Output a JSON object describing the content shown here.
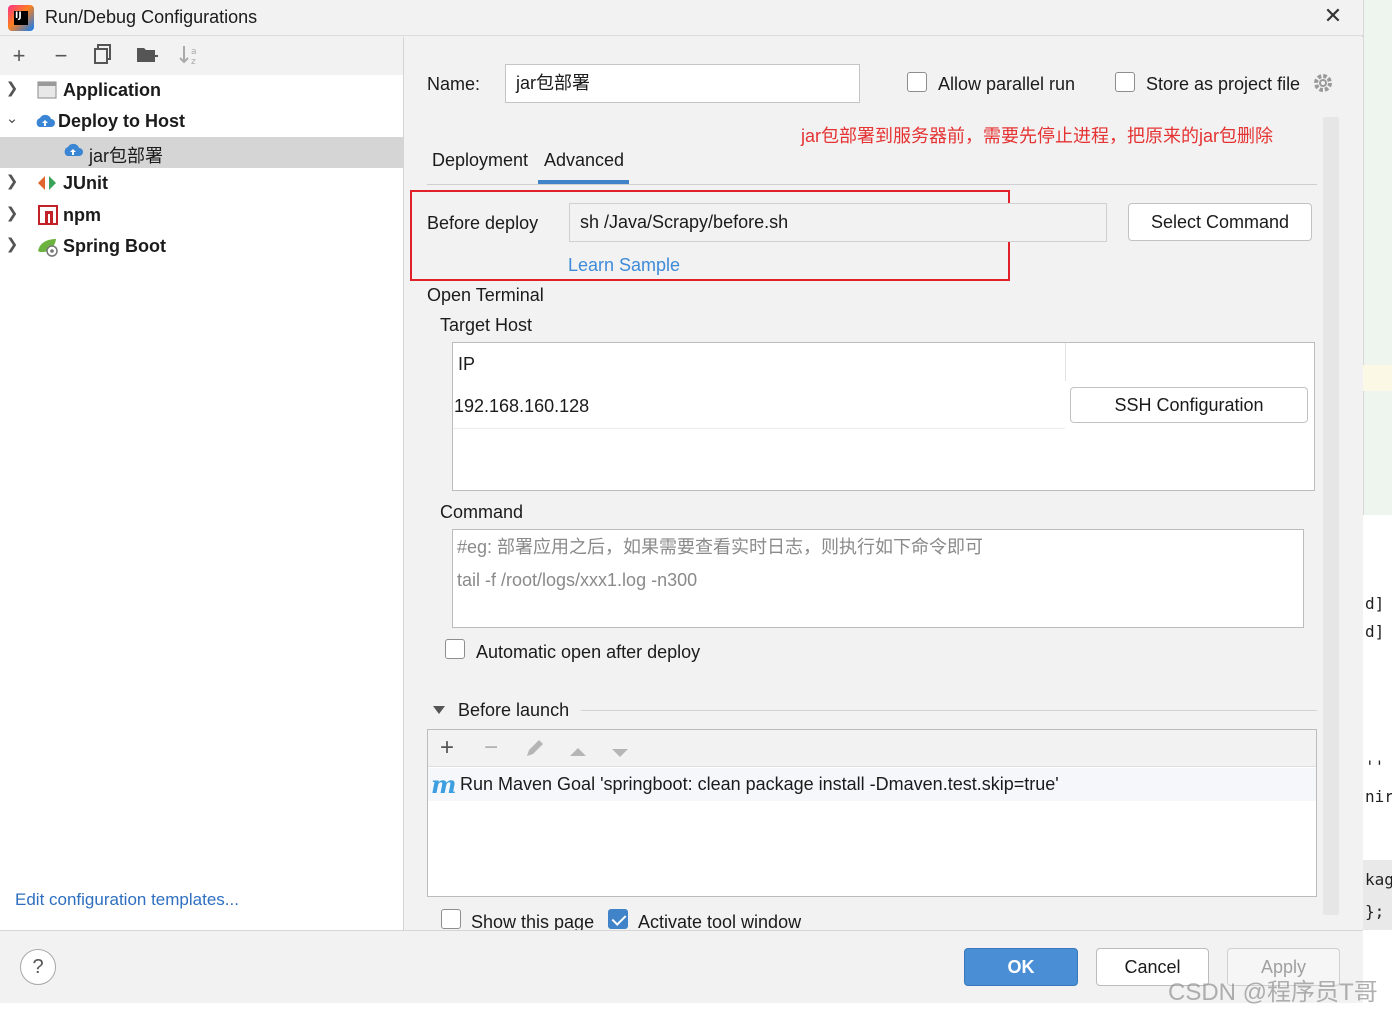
{
  "window": {
    "title": "Run/Debug Configurations"
  },
  "tree": {
    "items": [
      {
        "label": "Application"
      },
      {
        "label": "Deploy to Host"
      },
      {
        "label": "jar包部署"
      },
      {
        "label": "JUnit"
      },
      {
        "label": "npm"
      },
      {
        "label": "Spring Boot"
      }
    ],
    "edit_templates": "Edit configuration templates..."
  },
  "form": {
    "name_label": "Name:",
    "name_value": "jar包部署",
    "allow_parallel": "Allow parallel run",
    "store_project": "Store as project file",
    "annotation": "jar包部署到服务器前，需要先停止进程，把原来的jar包删除",
    "tabs": [
      "Deployment",
      "Advanced"
    ],
    "before_deploy_label": "Before deploy",
    "before_deploy_value": "sh /Java/Scrapy/before.sh",
    "select_command": "Select Command",
    "learn_sample": "Learn Sample",
    "open_terminal": "Open Terminal",
    "target_host": "Target Host",
    "ip_header": "IP",
    "ip_value": "192.168.160.128",
    "ssh_configuration": "SSH Configuration",
    "command_label": "Command",
    "command_placeholder_1": "#eg: 部署应用之后，如果需要查看实时日志，则执行如下命令即可",
    "command_placeholder_2": "tail -f /root/logs/xxx1.log -n300",
    "auto_open": "Automatic open after deploy",
    "before_launch": "Before launch",
    "maven_goal": "Run Maven Goal 'springboot: clean package install -Dmaven.test.skip=true'",
    "show_page": "Show this page",
    "activate_tool": "Activate tool window"
  },
  "buttons": {
    "help": "?",
    "ok": "OK",
    "cancel": "Cancel",
    "apply": "Apply"
  },
  "behind": {
    "line1": "d]",
    "line2": "d]",
    "line3": "''",
    "line4": "nir",
    "line5": "kag",
    "line6": "};"
  },
  "watermark": "CSDN @程序员T哥",
  "colors": {
    "accent": "#4083c9",
    "annotation": "#e53333",
    "link": "#3d8bd9"
  }
}
